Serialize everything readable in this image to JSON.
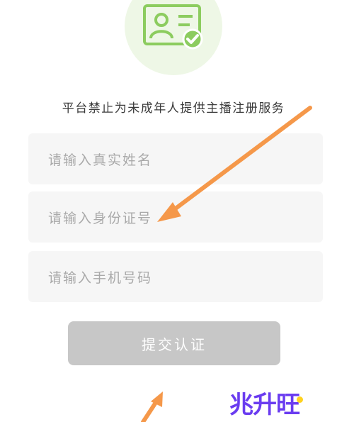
{
  "notice": "平台禁止为未成年人提供主播注册服务",
  "fields": {
    "name_placeholder": "请输入真实姓名",
    "id_placeholder": "请输入身份证号",
    "phone_placeholder": "请输入手机号码"
  },
  "submit_label": "提交认证",
  "watermark": "兆升旺",
  "colors": {
    "accent_green": "#8ccc5f",
    "annotation_arrow": "#f5984a",
    "button_disabled": "#c7c7c7",
    "watermark": "#6a3cf0"
  },
  "icons": [
    "id-card-verified-icon"
  ]
}
